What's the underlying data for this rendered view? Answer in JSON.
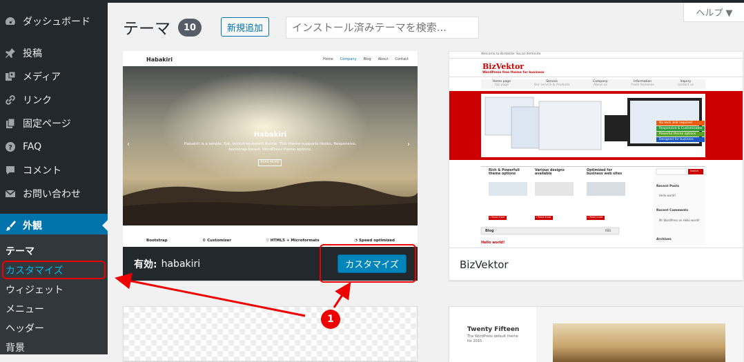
{
  "sidebar": {
    "items": [
      {
        "label": "ダッシュボード",
        "icon": "dashboard-icon"
      },
      {
        "label": "投稿",
        "icon": "pin-icon"
      },
      {
        "label": "メディア",
        "icon": "media-icon"
      },
      {
        "label": "リンク",
        "icon": "link-icon"
      },
      {
        "label": "固定ページ",
        "icon": "page-icon"
      },
      {
        "label": "FAQ",
        "icon": "question-icon"
      },
      {
        "label": "コメント",
        "icon": "comment-icon"
      },
      {
        "label": "お問い合わせ",
        "icon": "mail-icon"
      },
      {
        "label": "外観",
        "icon": "brush-icon"
      }
    ],
    "submenu": [
      "テーマ",
      "カスタマイズ",
      "ウィジェット",
      "メニュー",
      "ヘッダー",
      "背景"
    ]
  },
  "header": {
    "title": "テーマ",
    "count": "10",
    "add_new": "新規追加",
    "search_placeholder": "インストール済みテーマを検索...",
    "help": "ヘルプ ▼"
  },
  "themes": {
    "active": {
      "prefix": "有効:",
      "name": "habakiri",
      "customize": "カスタマイズ",
      "preview": {
        "site_name": "Habakiri",
        "nav": [
          "Home",
          "Company",
          "Blog",
          "About",
          "Contact"
        ],
        "hero_title": "Habakiri",
        "hero_text": "Habakiri is a simple, flat, bootstrap-based theme. This theme supports Hooks, Responsive, bootstrap-based. WordPress theme options.",
        "hero_button": "READ MORE",
        "features": [
          "Bootstrap",
          "⚙ Customizer",
          "▽ HTML5 + Microformats",
          "◔ Speed optimized"
        ]
      }
    },
    "bizvektor": {
      "name": "BizVektor",
      "preview": {
        "topline": "Welcome to BizVektor Social demosite",
        "logo": "BizVektor",
        "tagline": "WordPress free theme for business",
        "nav": [
          "Home page",
          "Service",
          "Company",
          "Information",
          "Inquiry"
        ],
        "nav_sub": [
          "top page",
          "Our service & Products",
          "About us",
          "Fresh Releases",
          "contact us"
        ],
        "badges": [
          "No tech skill required",
          "Responsive & Customizable",
          "Powerful theme options",
          "Designed for business"
        ],
        "features": [
          "Rich & Powerfull theme options",
          "Various designs available",
          "Optimized for business web sites"
        ],
        "read_more": "» Read more",
        "blog": "Blog",
        "rss": "RSS",
        "hello": "Hello world!",
        "search": "Search",
        "recent_posts": "Recent Posts",
        "hello_world": "Hello world!",
        "recent_comments": "Recent Comments",
        "comment": "Mr WordPress on Hello world!",
        "archives": "Archives"
      }
    },
    "twentyfifteen": {
      "preview_title": "Twenty Fifteen",
      "preview_text": "The WordPress default theme for 2015."
    }
  },
  "annotation": {
    "number": "1"
  },
  "colors": {
    "sidebar": "#23282d",
    "active": "#0073aa",
    "highlight": "#e00"
  }
}
